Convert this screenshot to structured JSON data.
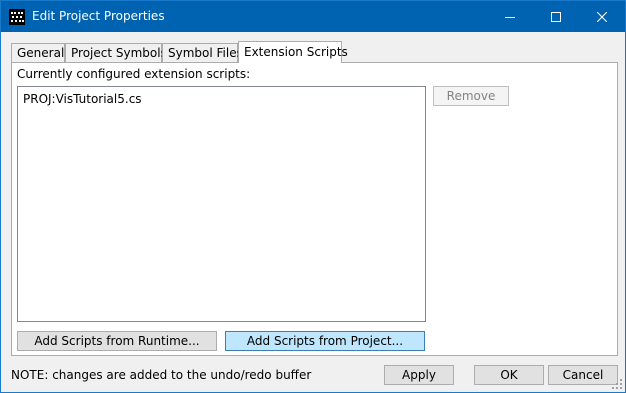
{
  "window": {
    "title": "Edit Project Properties",
    "accent_color": "#0063b1"
  },
  "titlebar": {
    "minimize_icon": "minimize-icon",
    "maximize_icon": "maximize-icon",
    "close_icon": "close-icon"
  },
  "tabs": [
    {
      "label": "General",
      "active": false
    },
    {
      "label": "Project Symbols",
      "active": false
    },
    {
      "label": "Symbol Files",
      "active": false
    },
    {
      "label": "Extension Scripts",
      "active": true
    }
  ],
  "scripts_panel": {
    "label": "Currently configured extension scripts:",
    "items": [
      "PROJ:VisTutorial5.cs"
    ],
    "remove_label": "Remove",
    "add_runtime_label": "Add Scripts from Runtime...",
    "add_project_label": "Add Scripts from Project..."
  },
  "footer": {
    "note": "NOTE: changes are added to the undo/redo buffer",
    "apply_label": "Apply",
    "ok_label": "OK",
    "cancel_label": "Cancel"
  }
}
